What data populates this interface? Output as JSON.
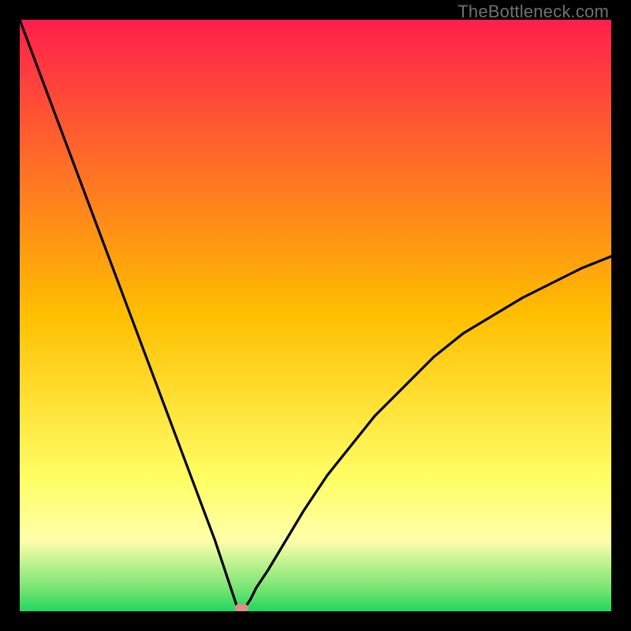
{
  "watermark": "TheBottleneck.com",
  "chart_data": {
    "type": "line",
    "title": "",
    "xlabel": "",
    "ylabel": "",
    "xlim": [
      0,
      100
    ],
    "ylim": [
      0,
      100
    ],
    "grid": false,
    "legend": false,
    "background_gradient": [
      {
        "pos": 0.0,
        "color": "#ff1f4c"
      },
      {
        "pos": 0.5,
        "color": "#ffbf00"
      },
      {
        "pos": 0.78,
        "color": "#ffff66"
      },
      {
        "pos": 0.88,
        "color": "#ffffaa"
      },
      {
        "pos": 0.965,
        "color": "#70e370"
      },
      {
        "pos": 1.0,
        "color": "#1fd65f"
      }
    ],
    "curve": {
      "description": "V-shaped bottleneck curve: bottleneck percentage vs parameter. Minimum (0% bottleneck) at x≈37. Left branch near-linear from (0,100) down to vertex; right branch concave rising toward (100,~60).",
      "x": [
        0,
        3,
        6,
        9,
        12,
        15,
        18,
        21,
        24,
        27,
        30,
        33,
        35,
        36,
        37,
        37.5,
        38,
        39,
        40,
        42,
        45,
        48,
        52,
        56,
        60,
        65,
        70,
        75,
        80,
        85,
        90,
        95,
        100
      ],
      "y": [
        100,
        92,
        84,
        76,
        68,
        60,
        52,
        44,
        36,
        28,
        20,
        12,
        6,
        3,
        0,
        0,
        0.5,
        2,
        4,
        7,
        12,
        17,
        23,
        28,
        33,
        38,
        43,
        47,
        50,
        53,
        55.5,
        58,
        60
      ],
      "vertex_x": 37.5,
      "vertex_marker": {
        "shape": "rounded-pill",
        "color": "#e58b87",
        "w": 2.2,
        "h": 1.2
      }
    }
  }
}
